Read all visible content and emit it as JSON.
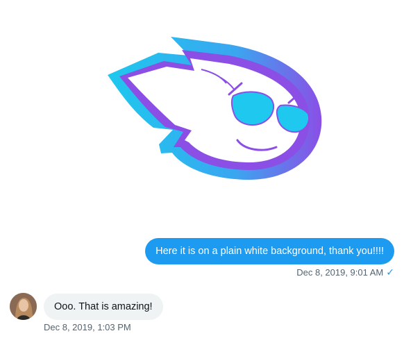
{
  "conversation": {
    "shared_image": {
      "icon": "flame-ghost-logo-icon",
      "colors": {
        "cyan": "#1ec8ee",
        "purple": "#8b4fe6",
        "white": "#ffffff"
      }
    },
    "outgoing": {
      "text": "Here it is on a plain white background, thank you!!!!",
      "timestamp": "Dec 8, 2019, 9:01 AM",
      "status_icon": "check-icon",
      "status_glyph": "✓",
      "bubble_color": "#1d9bf0"
    },
    "incoming": {
      "avatar_icon": "avatar",
      "text": "Ooo. That is amazing!",
      "timestamp": "Dec 8, 2019, 1:03 PM",
      "bubble_color": "#eff3f4"
    }
  }
}
